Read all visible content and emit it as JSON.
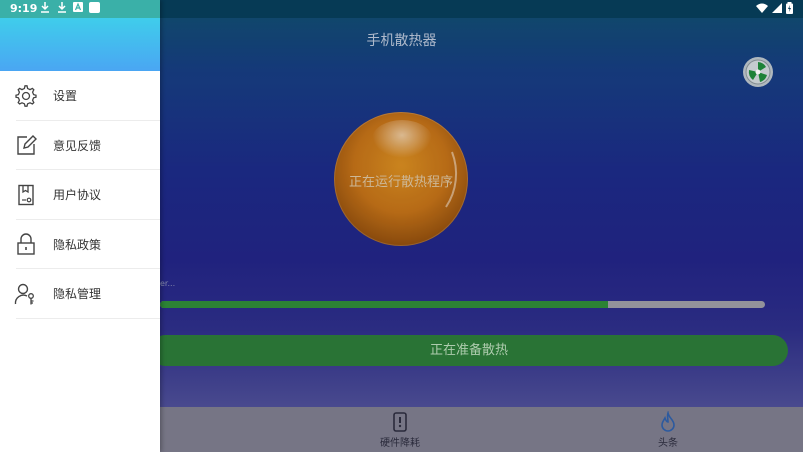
{
  "status_bar": {
    "time": "9:19",
    "left_icons": [
      "download-icon",
      "download-icon",
      "a-icon",
      "square-icon"
    ],
    "right_icons": [
      "wifi-icon",
      "signal-icon",
      "battery-icon"
    ]
  },
  "app": {
    "title": "手机散热器",
    "orb_text": "正在运行散热程序",
    "progress_hint": "er...",
    "progress_percent": 74,
    "action_button_label": "正在准备散热",
    "bottom_nav": [
      {
        "label": "硬件降耗",
        "icon": "phone-icon"
      },
      {
        "label": "头条",
        "icon": "flame-icon"
      }
    ]
  },
  "drawer": {
    "menu": [
      {
        "label": "设置",
        "icon": "gear-icon"
      },
      {
        "label": "意见反馈",
        "icon": "edit-icon"
      },
      {
        "label": "用户协议",
        "icon": "document-icon"
      },
      {
        "label": "隐私政策",
        "icon": "lock-icon"
      },
      {
        "label": "隐私管理",
        "icon": "user-key-icon"
      }
    ]
  },
  "colors": {
    "accent_green": "#2f8a38",
    "drawer_header": "#3fcdeb",
    "orb": "#c07018"
  }
}
